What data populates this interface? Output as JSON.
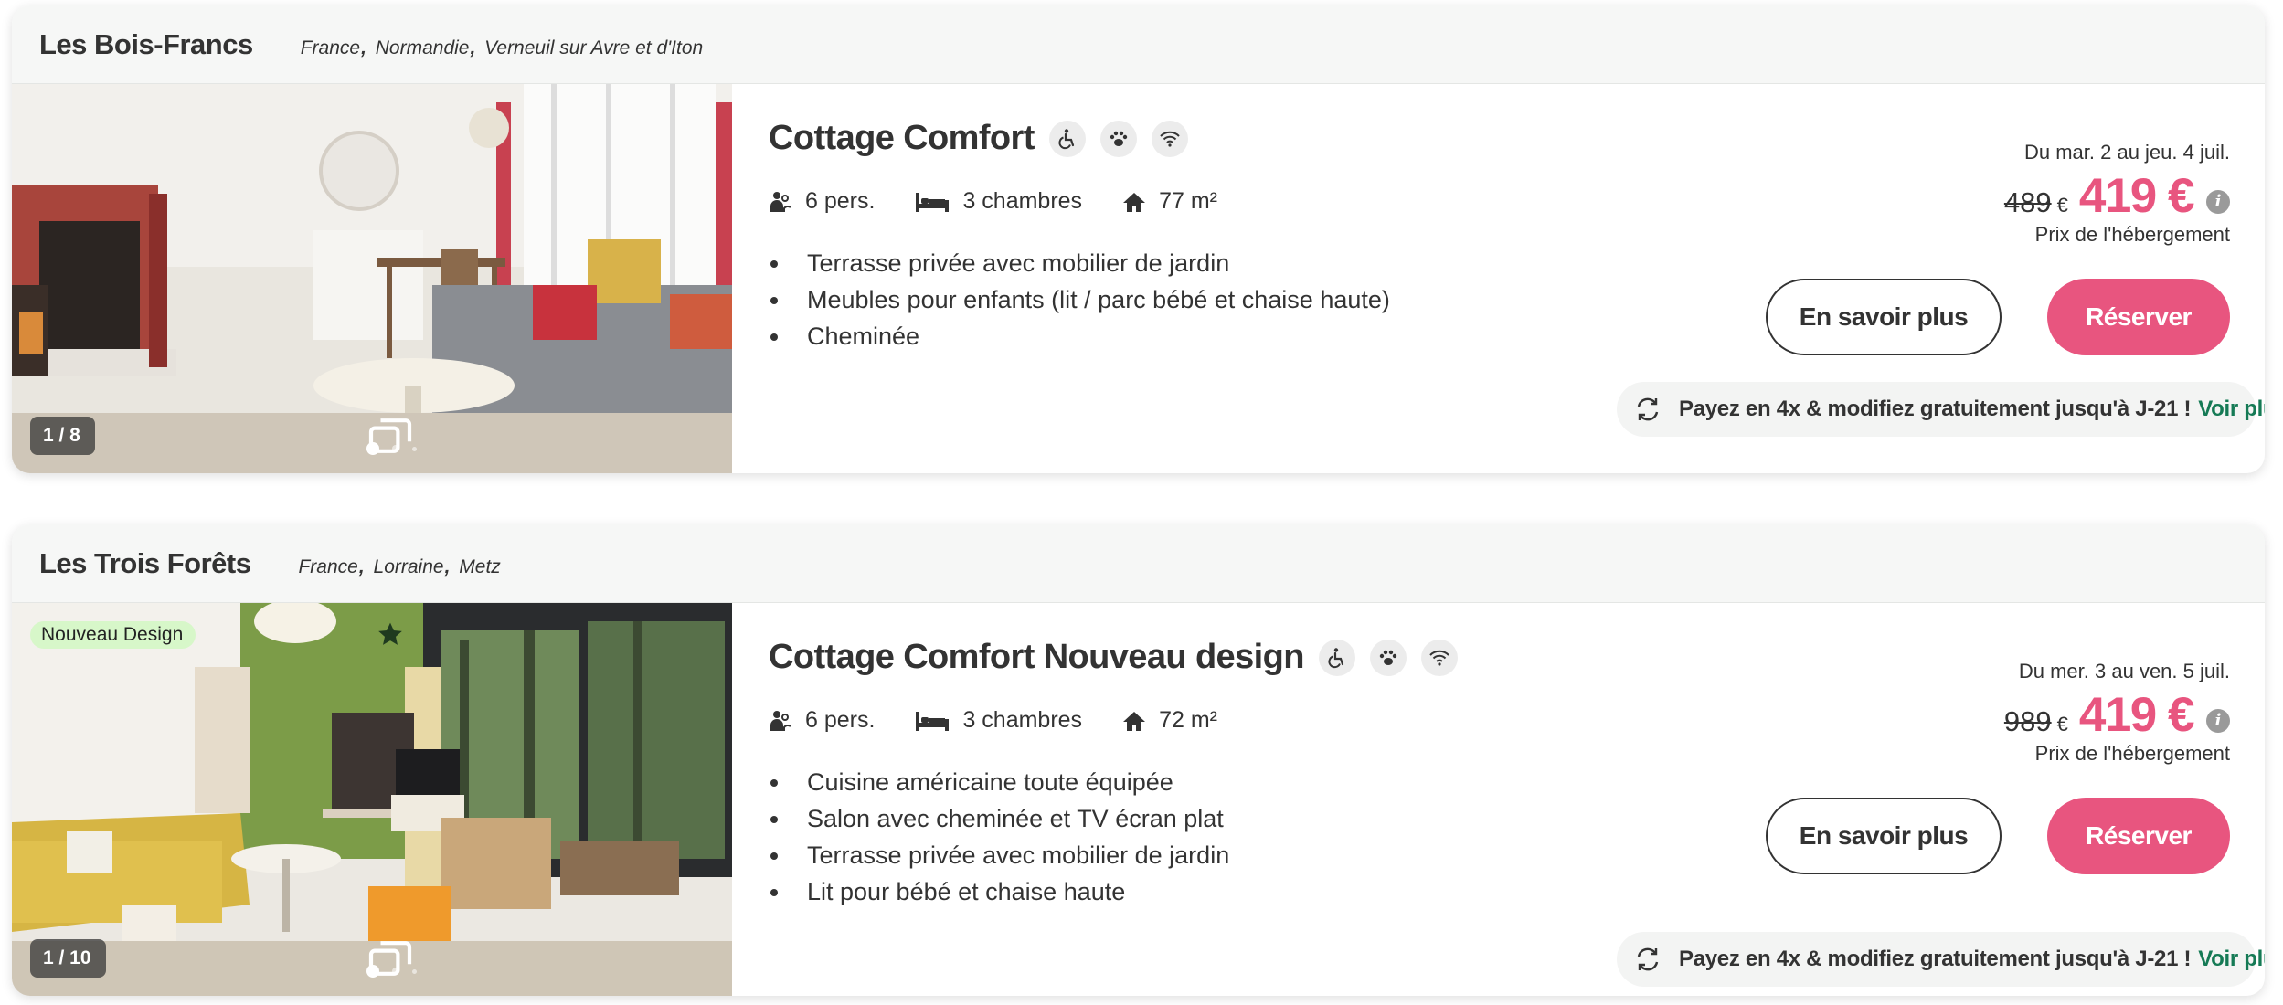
{
  "listings": [
    {
      "site_name": "Les Bois-Francs",
      "location": [
        "France",
        "Normandie",
        "Verneuil sur Avre et d'Iton"
      ],
      "photo_counter": "1 / 8",
      "badge": "",
      "title": "Cottage Comfort",
      "amenities": [
        "wheelchair-icon",
        "paw-icon",
        "wifi-icon"
      ],
      "persons": "6 pers.",
      "bedrooms": "3 chambres",
      "area": "77 m²",
      "features": [
        "Terrasse privée avec mobilier de jardin",
        "Meubles pour enfants (lit / parc bébé et chaise haute)",
        "Cheminée"
      ],
      "dates": "Du mar. 2 au jeu. 4 juil.",
      "old_price": "489",
      "old_currency": "€",
      "new_price": "419 €",
      "price_note": "Prix de l'hébergement",
      "more_label": "En savoir plus",
      "book_label": "Réserver",
      "pay_text": "Payez en 4x & modifiez gratuitement jusqu'à J-21 !",
      "pay_link": "Voir plus"
    },
    {
      "site_name": "Les Trois Forêts",
      "location": [
        "France",
        "Lorraine",
        "Metz"
      ],
      "photo_counter": "1 / 10",
      "badge": "Nouveau Design",
      "title": "Cottage Comfort Nouveau design",
      "amenities": [
        "wheelchair-icon",
        "paw-icon",
        "wifi-icon"
      ],
      "persons": "6 pers.",
      "bedrooms": "3 chambres",
      "area": "72 m²",
      "features": [
        "Cuisine américaine toute équipée",
        "Salon avec cheminée et TV écran plat",
        "Terrasse privée avec mobilier de jardin",
        "Lit pour bébé et chaise haute"
      ],
      "dates": "Du mer. 3 au ven. 5 juil.",
      "old_price": "989",
      "old_currency": "€",
      "new_price": "419 €",
      "price_note": "Prix de l'hébergement",
      "more_label": "En savoir plus",
      "book_label": "Réserver",
      "pay_text": "Payez en 4x & modifiez gratuitement jusqu'à J-21 !",
      "pay_link": "Voir plus"
    }
  ],
  "colors": {
    "accent": "#e8557f",
    "link": "#157a55",
    "badge_bg": "#d7f7c9"
  }
}
